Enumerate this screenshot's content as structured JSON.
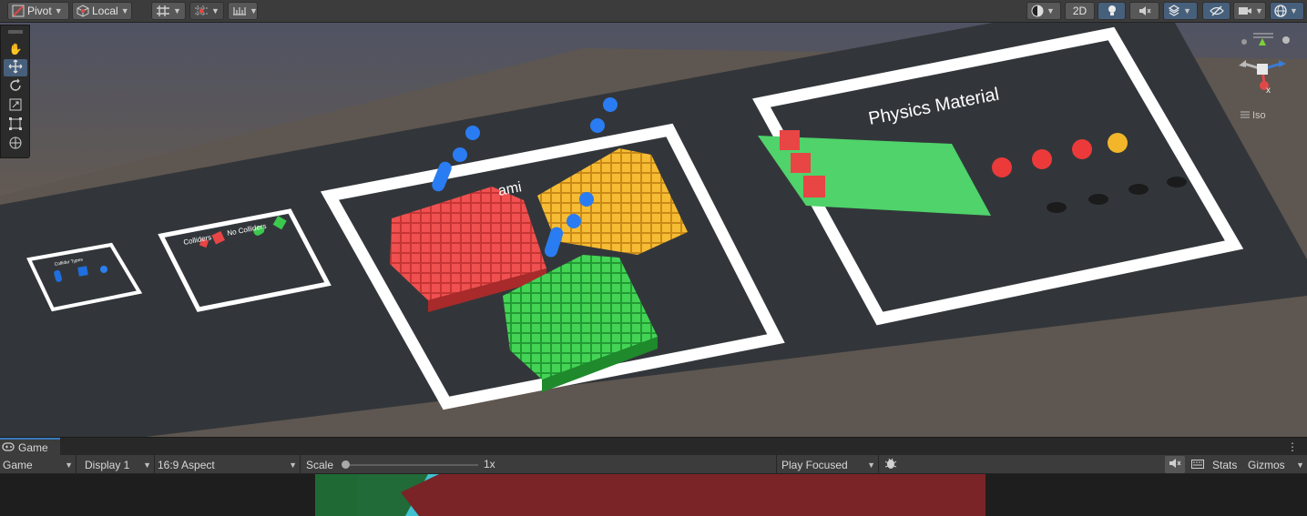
{
  "scene_toolbar": {
    "pivot_label": "Pivot",
    "local_label": "Local",
    "toggle_2d_label": "2D",
    "icons": [
      "pivot-icon",
      "local-icon",
      "grid-snap-icon",
      "increment-snap-icon",
      "ruler-icon",
      "shading-mode-icon",
      "lighting-icon",
      "audio-icon",
      "effects-icon",
      "scene-visibility-icon",
      "camera-icon",
      "gizmos-icon"
    ]
  },
  "tools": [
    "view-tool",
    "move-tool",
    "rotate-tool",
    "scale-tool",
    "rect-tool",
    "transform-tool"
  ],
  "scene": {
    "physics_material_label": "Physics Material",
    "center_label_fragment": "ami",
    "small_label_left": "Collider Types",
    "colliders_label": "Colliders",
    "no_colliders_label": "No Colliders",
    "colors": {
      "ground": "#5d5652",
      "sky": "#4a4a56",
      "platform": "#32363a",
      "frame": "#ffffff",
      "red": "#e84545",
      "yellow": "#f3b52a",
      "green": "#3cc84d",
      "blue": "#1f6fe0",
      "plane": "#4fd36a"
    }
  },
  "gizmo": {
    "view_label": "Iso",
    "axis_label": "x"
  },
  "game": {
    "tab_label": "Game",
    "mode_label": "Game",
    "display_label": "Display 1",
    "aspect_label": "16:9 Aspect",
    "scale_label": "Scale",
    "scale_value": "1x",
    "scale_fraction": 0.0,
    "play_mode_label": "Play Focused",
    "stats_label": "Stats",
    "gizmos_label": "Gizmos"
  }
}
